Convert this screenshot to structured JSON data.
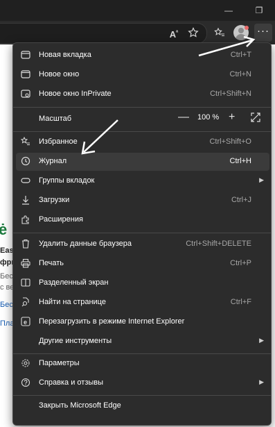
{
  "window": {
    "minimize_glyph": "—",
    "restore_glyph": "❐"
  },
  "toolbar": {
    "read_aloud_glyph": "A",
    "read_aloud_sup": "ᵃ",
    "more_glyph": "···"
  },
  "page_fragments": [
    "Eas",
    "фри",
    "Бес",
    "с ве",
    "Бес",
    "Пла"
  ],
  "menu": {
    "items": [
      {
        "label": "Новая вкладка",
        "shortcut": "Ctrl+T",
        "icon": "new-tab-icon"
      },
      {
        "label": "Новое окно",
        "shortcut": "Ctrl+N",
        "icon": "new-window-icon"
      },
      {
        "label": "Новое окно InPrivate",
        "shortcut": "Ctrl+Shift+N",
        "icon": "inprivate-icon"
      },
      {
        "label": "Избранное",
        "shortcut": "Ctrl+Shift+O",
        "icon": "favorites-icon"
      },
      {
        "label": "Журнал",
        "shortcut": "Ctrl+H",
        "icon": "history-icon"
      },
      {
        "label": "Группы вкладок",
        "shortcut": "",
        "icon": "tab-groups-icon"
      },
      {
        "label": "Загрузки",
        "shortcut": "Ctrl+J",
        "icon": "download-icon"
      },
      {
        "label": "Расширения",
        "shortcut": "",
        "icon": "extensions-icon"
      },
      {
        "label": "Удалить данные браузера",
        "shortcut": "Ctrl+Shift+DELETE",
        "icon": "trash-icon"
      },
      {
        "label": "Печать",
        "shortcut": "Ctrl+P",
        "icon": "print-icon"
      },
      {
        "label": "Разделенный экран",
        "shortcut": "",
        "icon": "split-screen-icon"
      },
      {
        "label": "Найти на странице",
        "shortcut": "Ctrl+F",
        "icon": "find-icon"
      },
      {
        "label": "Перезагрузить в режиме Internet Explorer",
        "shortcut": "",
        "icon": "ie-icon"
      },
      {
        "label": "Другие инструменты",
        "shortcut": "",
        "icon": ""
      },
      {
        "label": "Параметры",
        "shortcut": "",
        "icon": "settings-icon"
      },
      {
        "label": "Справка и отзывы",
        "shortcut": "",
        "icon": "help-icon"
      },
      {
        "label": "Закрыть Microsoft Edge",
        "shortcut": "",
        "icon": ""
      }
    ],
    "zoom": {
      "label": "Масштаб",
      "value": "100 %",
      "minus": "—",
      "plus": "+"
    },
    "highlight_color": "#3b3b3b",
    "background_color": "#2c2c2c"
  }
}
